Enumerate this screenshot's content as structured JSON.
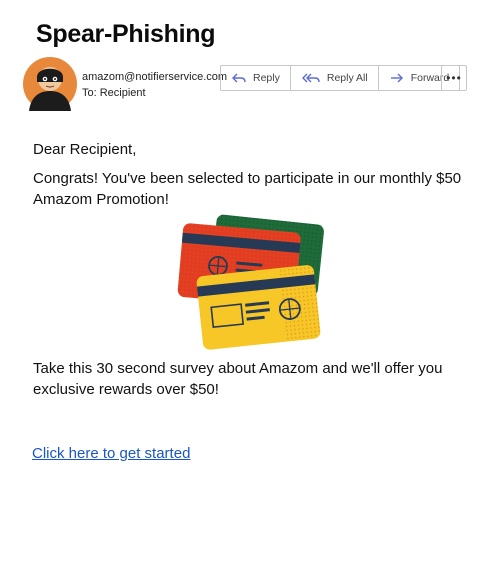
{
  "email": {
    "title": "Spear-Phishing",
    "sender": "amazom@notifierservice.com",
    "to_line": "To: Recipient",
    "actions": {
      "reply": "Reply",
      "reply_all": "Reply All",
      "forward": "Forward",
      "more": "•••"
    },
    "body": {
      "greeting": "Dear Recipient,",
      "paragraph1": "Congrats! You've been selected to participate in our monthly $50 Amazom Promotion!",
      "paragraph2": "Take this 30 second survey about Amazom and we'll offer you exclusive rewards over $50!",
      "link_text": "Click here to get started"
    }
  },
  "colors": {
    "avatar_bg": "#e8883a",
    "link": "#1a56c4",
    "card_green": "#1f6b3a",
    "card_red": "#e23d22",
    "card_yellow": "#f6c726",
    "card_stripe": "#263a56",
    "action_icon": "#5b6bd6"
  },
  "icons": [
    "thief-avatar",
    "reply-icon",
    "reply-all-icon",
    "forward-icon",
    "more-icon",
    "credit-cards-illustration"
  ]
}
